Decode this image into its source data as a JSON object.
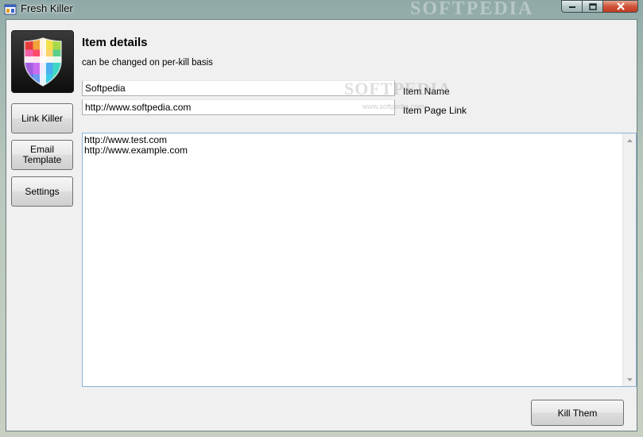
{
  "window": {
    "title": "Fresh Killer",
    "watermark": "SOFTPEDIA"
  },
  "sidebar": {
    "buttons": [
      {
        "label": "Link Killer"
      },
      {
        "label": "Email Template"
      },
      {
        "label": "Settings"
      }
    ]
  },
  "details": {
    "heading": "Item details",
    "subheading": "can be changed on per-kill basis",
    "item_name_value": "Softpedia",
    "item_name_label": "Item Name",
    "item_link_value": "http://www.softpedia.com",
    "item_link_label": "Item Page Link"
  },
  "urls": {
    "lines": [
      "http://www.test.com",
      "http://www.example.com"
    ]
  },
  "actions": {
    "kill_label": "Kill Them"
  },
  "watermark": {
    "mid": "SOFTPEDIA",
    "small": "www.softpedia.com"
  },
  "icons": {
    "app": "app-window-icon",
    "logo": "shield-logo-icon"
  },
  "colors": {
    "client_bg": "#f0f0f0",
    "textarea_border": "#8ab2d6",
    "close_button": "#c33c22"
  }
}
